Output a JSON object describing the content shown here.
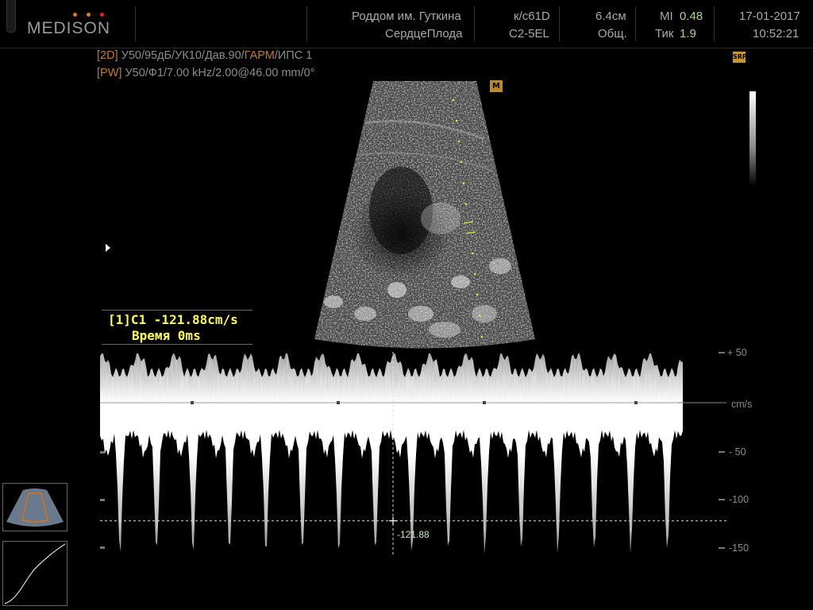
{
  "header": {
    "logo": "MEDISON",
    "logo_dot_colors": [
      "#e07a1a",
      "#e07a1a",
      "#d9281a"
    ],
    "hospital": "Роддом им. Гуткина",
    "exam": "СердцеПлода",
    "operator": "к/с61D",
    "probe": "C2-5EL",
    "depth": "6.4см",
    "preset": "Общ.",
    "mi_label": "MI",
    "mi_value": "0.48",
    "ti_label": "Тик",
    "ti_value": "1.9",
    "date": "17-01-2017",
    "time": "10:52:21"
  },
  "params": {
    "line_2d_tag": "[2D]",
    "line_2d_text": " У50/95дБ/УК10/Дав.90/",
    "line_2d_harm": "ГАРМ",
    "line_2d_end": "/ИПС 1",
    "line_pw_tag": "[PW]",
    "line_pw_text": " У50/Ф1/7.00 kHz/2.00@46.00 mm/0°"
  },
  "badges": {
    "sri": "SRF",
    "marker": "M"
  },
  "measurement": {
    "line1": "[1]C1 -121.88cm/s",
    "line2": "Время 0ms",
    "cursor_value": "-121.88",
    "cursor_velocity": -121.88
  },
  "scale": {
    "unit": "cm/s",
    "labels": [
      "+ 50",
      "- 50",
      "-100",
      "-150"
    ],
    "values": [
      50,
      -50,
      -100,
      -150
    ],
    "baseline": 0
  },
  "colors": {
    "accent_yellow": "#ffff55",
    "param_orange": "#c27a2a",
    "header_green": "#b4d27a"
  }
}
